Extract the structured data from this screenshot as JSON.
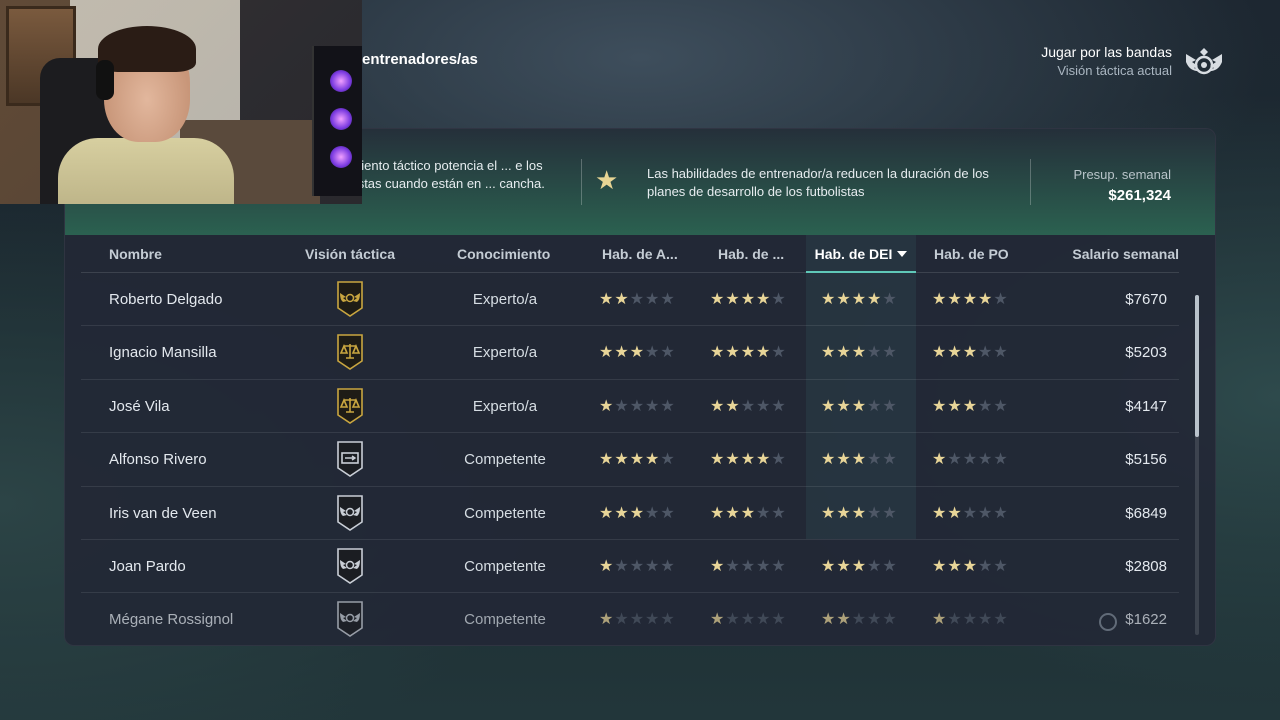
{
  "header": {
    "title": "entrenadores/as",
    "tactic_name": "Jugar por las bandas",
    "tactic_sub": "Visión táctica actual"
  },
  "info": {
    "left_text": "...ocimiento táctico potencia el ... e los futbolistas cuando están en ... cancha.",
    "mid_text": "Las habilidades de entrenador/a reducen la duración de los planes de desarrollo de los futbolistas",
    "budget_label": "Presup. semanal",
    "budget_value": "$261,324"
  },
  "table": {
    "columns": [
      "Nombre",
      "Visión táctica",
      "Conocimiento",
      "Hab. de A...",
      "Hab. de ...",
      "Hab. de DEI",
      "Hab. de PO",
      "Salario semanal"
    ],
    "sorted_column": "Hab. de DEI",
    "rows": [
      {
        "name": "Roberto Delgado",
        "vision_icon": "wings-crest-icon",
        "vision_color": "gold",
        "level": "Experto/a",
        "a": 2,
        "b": 4,
        "dei": 4,
        "po": 4,
        "salary": "$7670"
      },
      {
        "name": "Ignacio Mansilla",
        "vision_icon": "scales-crest-icon",
        "vision_color": "gold",
        "level": "Experto/a",
        "a": 3,
        "b": 4,
        "dei": 3,
        "po": 3,
        "salary": "$5203"
      },
      {
        "name": "José Vila",
        "vision_icon": "scales-crest-icon",
        "vision_color": "gold",
        "level": "Experto/a",
        "a": 1,
        "b": 2,
        "dei": 3,
        "po": 3,
        "salary": "$4147"
      },
      {
        "name": "Alfonso Rivero",
        "vision_icon": "gate-crest-icon",
        "vision_color": "dark",
        "level": "Competente",
        "a": 4,
        "b": 4,
        "dei": 3,
        "po": 1,
        "salary": "$5156"
      },
      {
        "name": "Iris van de Veen",
        "vision_icon": "wings-crest-icon",
        "vision_color": "dark",
        "level": "Competente",
        "a": 3,
        "b": 3,
        "dei": 3,
        "po": 2,
        "salary": "$6849"
      },
      {
        "name": "Joan Pardo",
        "vision_icon": "wings-crest-icon",
        "vision_color": "dark",
        "level": "Competente",
        "a": 1,
        "b": 1,
        "dei": 3,
        "po": 3,
        "salary": "$2808"
      },
      {
        "name": "Mégane Rossignol",
        "vision_icon": "wings-crest-icon",
        "vision_color": "dark",
        "level": "Competente",
        "a": 1,
        "b": 1,
        "dei": 2,
        "po": 1,
        "salary": "$1622"
      }
    ]
  },
  "colors": {
    "star_on": "#e8d598",
    "star_off": "#4e5766",
    "accent": "#5fc8b8",
    "gold_badge": "#c9a640"
  }
}
